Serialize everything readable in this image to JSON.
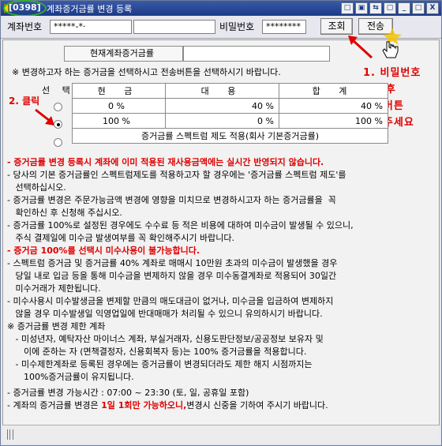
{
  "window": {
    "code": "[0398]",
    "title": "계좌증거금률 변경 등록",
    "buttons": [
      "□",
      "▣",
      "⇆",
      "▢",
      "_",
      "□",
      "X"
    ]
  },
  "toolbar": {
    "account_label": "계좌번호",
    "account_value": "*****-*·",
    "password_label": "비밀번호",
    "password_value": "********",
    "query_label": "조회",
    "send_label": "전송"
  },
  "current": {
    "label": "현재계좌증거금률",
    "value": ""
  },
  "guide_text": "※ 변경하고자 하는 증거금을 선택하시고 전송버튼을 선택하시기 바랍니다.",
  "annotations": {
    "step1": [
      "1. 비밀번호",
      "입력후",
      "조회버튼",
      "클릭주세요"
    ],
    "step2": "2. 클릭"
  },
  "selection_table": {
    "select_header": "선 택",
    "columns": [
      "현 금",
      "대 용",
      "합 계"
    ],
    "rows": [
      {
        "cash": "0 %",
        "sub": "40 %",
        "total": "40 %",
        "selected": false
      },
      {
        "cash": "100 %",
        "sub": "0 %",
        "total": "100 %",
        "selected": true
      }
    ],
    "special_row": "증거금률 스펙트럼 제도 적용(회사 기본증거금률)"
  },
  "notes": [
    {
      "style": "red",
      "text": "- 증거금률 변경 등록시 계좌에 이미 적용된 재사용금액에는 실시간 반영되지 않습니다."
    },
    {
      "style": "plain",
      "text": "- 당사의 기본 증거금률인 스펙트럼제도를 적용하고자 할 경우에는 '증거금률 스펙트럼 제도'를"
    },
    {
      "style": "plain",
      "text": "   선택하십시오."
    },
    {
      "style": "plain",
      "text": "- 증거금률 변경은 주문가능금액 변경에 영향을 미치므로 변경하시고자 하는 증거금률을  꼭"
    },
    {
      "style": "plain",
      "text": "   확인하신 후 신청해 주십시오."
    },
    {
      "style": "plain",
      "text": "- 증거금률 100%로 설정된 경우에도 수수료 등 적은 비용에 대하여 미수금이 발생될 수 있으니,"
    },
    {
      "style": "plain",
      "text": "   주식 결제일에 미수금 발생여부를 꼭 확인해주시기 바랍니다."
    },
    {
      "style": "red",
      "text": "- 증거금 100%를 선택시 미수사용이 불가능합니다."
    },
    {
      "style": "plain",
      "text": "- 스펙트럼 증거금 및 증거금률 40% 계좌로 매매시 10만원 초과의 미수금이 발생했을 경우"
    },
    {
      "style": "plain",
      "text": "   당일 내로 입금 등을 통해 미수금을 변제하지 않을 경우 미수동결계좌로 적용되어 30일간"
    },
    {
      "style": "plain",
      "text": "   미수거래가 제한됩니다."
    },
    {
      "style": "plain",
      "text": "- 미수사용시 미수발생금을 변제할 만큼의 매도대금이 없거나, 미수금을 입금하여 변제하지"
    },
    {
      "style": "plain",
      "text": "   않을 경우 미수발생일 익영업일에 반대매매가 처리될 수 있으니 유의하시기 바랍니다."
    },
    {
      "style": "plain",
      "text": "※ 증거금률 변경 제한 계좌"
    },
    {
      "style": "plain",
      "text": "   - 미성년자, 예탁자산 마이너스 계좌, 부실거래자, 신용도판단정보/공공정보 보유자 및"
    },
    {
      "style": "plain",
      "text": "      이에 준하는 자 (면책결정자, 신용회복자 등)는 100% 증거금률을 적용합니다."
    },
    {
      "style": "plain",
      "text": "   - 미수제한계좌로 등록된 경우에는 증거금률이 변경되더라도 제한 해지 시점까지는"
    },
    {
      "style": "plain",
      "text": "      100%증거금률이 유지됩니다."
    },
    {
      "style": "plain",
      "text": "- 증거금률 변경 가능시간 : 07:00 ~ 23:30 (토, 일, 공휴일 포함)"
    },
    {
      "style": "mixed",
      "text": "- 계좌의 증거금률 변경은 ",
      "highlight": "1일 1회만 가능하오니,",
      "tail": "변경시 신중을 기하여 주시기 바랍니다."
    }
  ],
  "colors": {
    "title_bar": "#1b3a88",
    "annotation_red": "#e00000",
    "highlight_oval": "#2fb02f"
  }
}
